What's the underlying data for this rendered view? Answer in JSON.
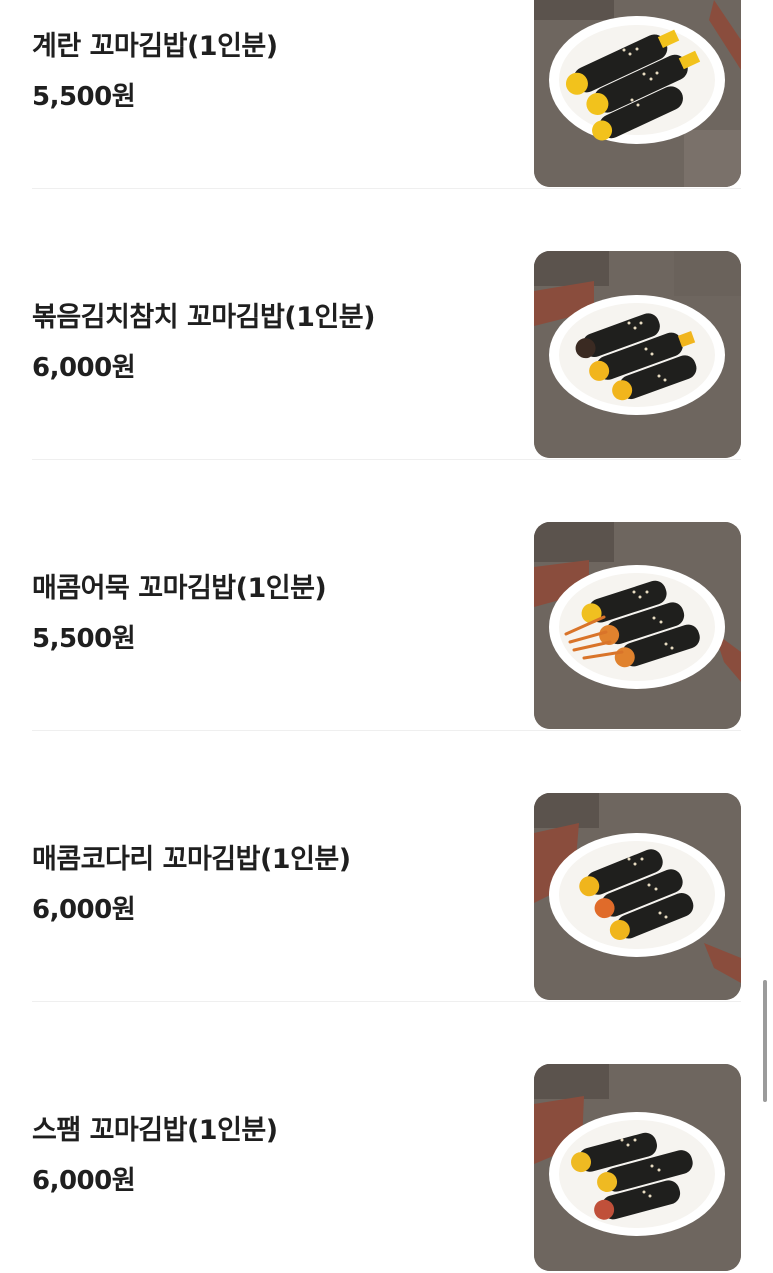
{
  "menu_items": [
    {
      "name": "계란 꼬마김밥(1인분)",
      "price": "5,500원",
      "image": "egg-kimbap-photo",
      "filling_color": "#f2c21c"
    },
    {
      "name": "볶음김치참치 꼬마김밥(1인분)",
      "price": "6,000원",
      "image": "kimchi-tuna-kimbap-photo",
      "filling_color": "#f1b51d"
    },
    {
      "name": "매콤어묵 꼬마김밥(1인분)",
      "price": "5,500원",
      "image": "spicy-fishcake-kimbap-photo",
      "filling_color": "#e0822e"
    },
    {
      "name": "매콤코다리 꼬마김밥(1인분)",
      "price": "6,000원",
      "image": "spicy-kodari-kimbap-photo",
      "filling_color": "#e06b2a"
    },
    {
      "name": "스팸 꼬마김밥(1인분)",
      "price": "6,000원",
      "image": "spam-kimbap-photo",
      "filling_color": "#efba22"
    }
  ],
  "colors": {
    "text": "#1f1f1f",
    "divider": "#efefef",
    "seaweed": "#1f1f1d",
    "plate": "#ffffff",
    "stone": "#6e665f"
  }
}
